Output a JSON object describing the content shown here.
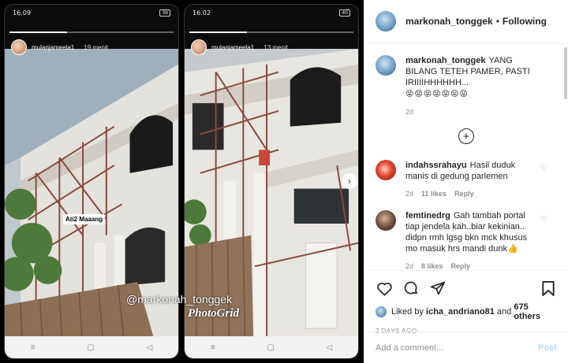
{
  "media": {
    "left_phone": {
      "clock": "16.09",
      "battery": "39",
      "story_user": "mulanjameela1",
      "story_time": "19 menit",
      "sticker_text": "Ati2 Maaang"
    },
    "right_phone": {
      "clock": "16.02",
      "battery": "40",
      "story_user": "mulanjameela1",
      "story_time": "13 menit"
    },
    "watermark_text": "@markonah_tonggek",
    "photogrid_text": "PhotoGrid",
    "navbar_glyphs": [
      "≡",
      "▢",
      "◁"
    ],
    "next_arrow": "›"
  },
  "header": {
    "username": "markonah_tonggek",
    "separator": "•",
    "follow_label": "Following",
    "more_label": "···"
  },
  "caption": {
    "username": "markonah_tonggek",
    "text": "YANG BILANG TETEH PAMER, PASTI IRIIIIHHHHHH...",
    "emojis": "😝😝😝😝😝😝😝",
    "age": "2d"
  },
  "load_more_label": "+",
  "comments": [
    {
      "username": "indahssrahayu",
      "text": "Hasil duduk manis di gedung parlemen",
      "age": "2d",
      "likes": "11 likes",
      "reply": "Reply"
    },
    {
      "username": "femtinedrg",
      "text": "Gah tambah portal tiap jendela kah..biar kekinian.. didpn rmh lgsg bkn mck khusus mo masuk hrs mandi dunk👍",
      "age": "2d",
      "likes": "8 likes",
      "reply": "Reply"
    }
  ],
  "likes": {
    "prefix": "Liked by ",
    "user": "icha_andriano81",
    "conj": " and ",
    "others": "675 others"
  },
  "date": "2 DAYS AGO",
  "add_comment": {
    "placeholder": "Add a comment...",
    "post_label": "Post"
  }
}
